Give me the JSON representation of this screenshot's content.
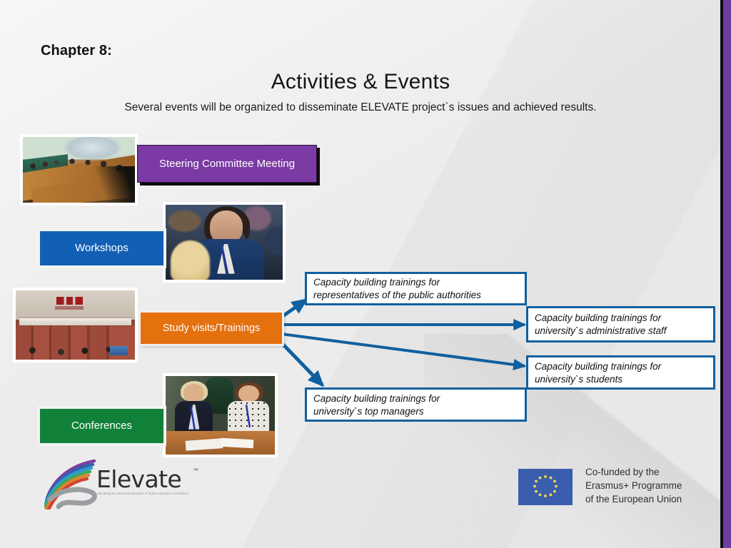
{
  "slide": {
    "chapter_label": "Chapter 8:",
    "title": "Activities & Events",
    "subtitle": "Several events will be organized to disseminate ELEVATE project`s issues and achieved results."
  },
  "categories": [
    {
      "id": "steering",
      "label": "Steering Committee Meeting",
      "color": "#7b3aa4"
    },
    {
      "id": "workshops",
      "label": "Workshops",
      "color": "#1260b5"
    },
    {
      "id": "study",
      "label": "Study visits/Trainings",
      "color": "#e4700e"
    },
    {
      "id": "conferences",
      "label": "Conferences",
      "color": "#11813a"
    }
  ],
  "outcomes": [
    {
      "id": "public",
      "line1": "Capacity building trainings for",
      "line2": "representatives of the public authorities"
    },
    {
      "id": "admin",
      "line1": "Capacity building trainings for",
      "line2": "university`s administrative staff"
    },
    {
      "id": "students",
      "line1": "Capacity building trainings for",
      "line2": "university`s students"
    },
    {
      "id": "top",
      "line1": "Capacity building trainings for",
      "line2": "university`s top managers"
    }
  ],
  "photos": [
    {
      "id": "meeting",
      "alt": "Board meeting room with long wooden table"
    },
    {
      "id": "woman",
      "alt": "Woman in blue blazer at a conference"
    },
    {
      "id": "hall",
      "alt": "Lecture hall with red seats"
    },
    {
      "id": "two",
      "alt": "Two women seated at a conference table"
    }
  ],
  "branding": {
    "elevate_word": "Elevate",
    "elevate_tm": "™",
    "elevate_tagline": "Elevating the internationalisation of higher education in Moldova",
    "eu_line1": "Co-funded by the",
    "eu_line2": "Erasmus+ Programme",
    "eu_line3": "of the European Union"
  },
  "theme": {
    "background": "#e9e9e9",
    "edge_purple": "#6b3fa0",
    "edge_black": "#0d0d14",
    "arrow_blue": "#10609f"
  }
}
